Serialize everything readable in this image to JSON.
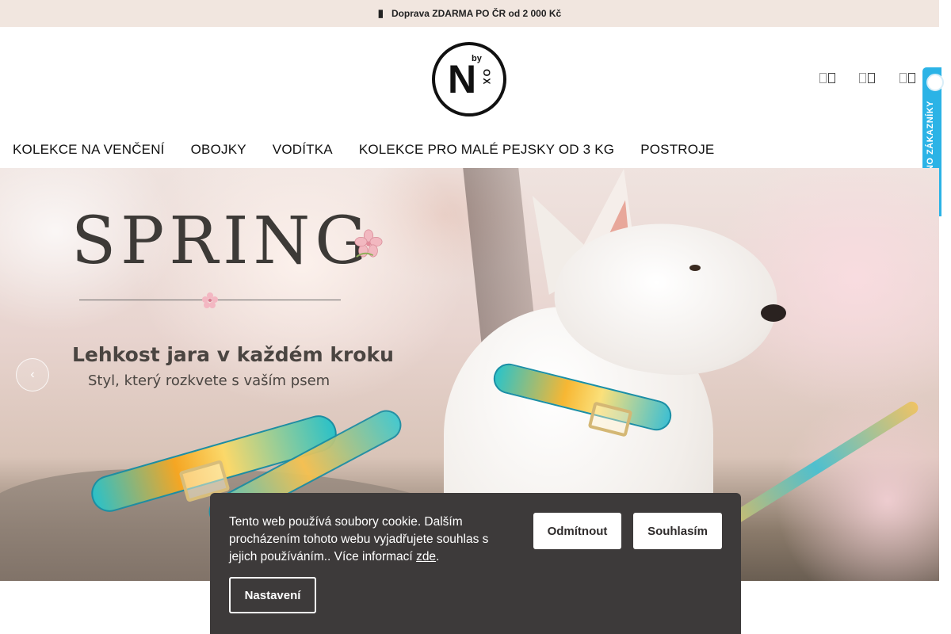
{
  "promo": {
    "icon": "truck-icon",
    "text": "Doprava ZDARMA PO ČR od 2 000 Kč"
  },
  "header": {
    "logo_text_by": "by",
    "logo_text_n": "N",
    "logo_text_ox": "OX",
    "icons": [
      "search-icon",
      "user-icon",
      "cart-icon"
    ]
  },
  "verified_badge": {
    "text": "OVĚŘENO ZÁKAZNÍKY",
    "color": "#2bb3e6"
  },
  "nav": {
    "items": [
      {
        "label": "KOLEKCE NA VENČENÍ"
      },
      {
        "label": "OBOJKY"
      },
      {
        "label": "VODÍTKA"
      },
      {
        "label": "KOLEKCE PRO MALÉ PEJSKY OD 3 KG"
      },
      {
        "label": "POSTROJE"
      }
    ]
  },
  "hero": {
    "title": "SPRING",
    "subtitle": "Lehkost jara v každém kroku",
    "tagline": "Styl, který rozkvete s vaším psem",
    "prev_icon": "chevron-left-icon"
  },
  "cookie": {
    "text": "Tento web používá soubory cookie. Dalším procházením tohoto webu vyjadřujete souhlas s jejich používáním.. Více informací",
    "more_link": "zde",
    "period": ".",
    "reject_label": "Odmítnout",
    "accept_label": "Souhlasím",
    "settings_label": "Nastavení"
  }
}
